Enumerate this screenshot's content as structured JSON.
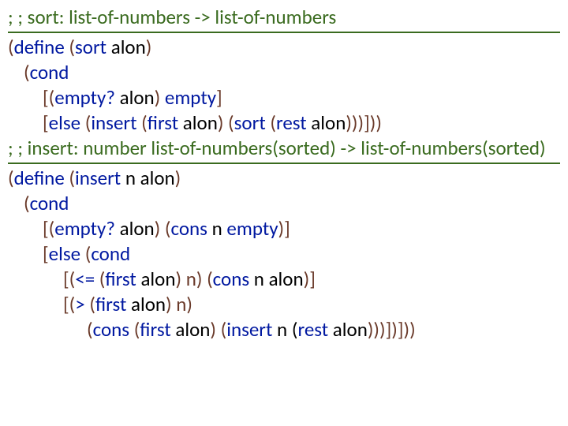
{
  "code": {
    "c1": "; ; sort: list-of-numbers -> list-of-numbers",
    "l1_a": "(",
    "l1_b": "define",
    "l1_c": " (",
    "l1_d": "sort",
    "l1_e": " alon",
    "l1_f": ")",
    "l2_a": "(",
    "l2_b": "cond",
    "l3_a": "[(",
    "l3_b": "empty?",
    "l3_c": " alon",
    "l3_d": ") ",
    "l3_e": "empty",
    "l3_f": "]",
    "l4_a": "[",
    "l4_b": "else",
    "l4_c": " (",
    "l4_d": "insert",
    "l4_e": " (",
    "l4_f": "first",
    "l4_g": " alon",
    "l4_h": ") (",
    "l4_i": "sort",
    "l4_j": " (",
    "l4_k": "rest",
    "l4_l": " alon",
    "l4_m": ")))]))",
    "c2": "; ; insert: number list-of-numbers(sorted) -> list-of-numbers(sorted)",
    "l5_a": "(",
    "l5_b": "define",
    "l5_c": " (",
    "l5_d": "insert",
    "l5_e": " n alon",
    "l5_f": ")",
    "l6_a": "(",
    "l6_b": "cond",
    "l7_a": "[(",
    "l7_b": "empty?",
    "l7_c": " alon",
    "l7_d": ") (",
    "l7_e": "cons",
    "l7_f": " n ",
    "l7_g": "empty",
    "l7_h": ")]",
    "l8_a": "[",
    "l8_b": "else",
    "l8_c": " (",
    "l8_d": "cond",
    "l9_a": "[(",
    "l9_b": "<=",
    "l9_c": " (",
    "l9_d": "first",
    "l9_e": " alon",
    "l9_f": ") n) (",
    "l9_g": "cons",
    "l9_h": " n alon",
    "l9_i": ")]",
    "l10_a": "[(",
    "l10_b": ">",
    "l10_c": " (",
    "l10_d": "first",
    "l10_e": " alon",
    "l10_f": ") n)",
    "l11_a": "(",
    "l11_b": "cons",
    "l11_c": " (",
    "l11_d": "first",
    "l11_e": " alon",
    "l11_f": ") (",
    "l11_g": "insert",
    "l11_h": " n (",
    "l11_i": "rest",
    "l11_j": " alon",
    "l11_k": ")))])]))"
  }
}
